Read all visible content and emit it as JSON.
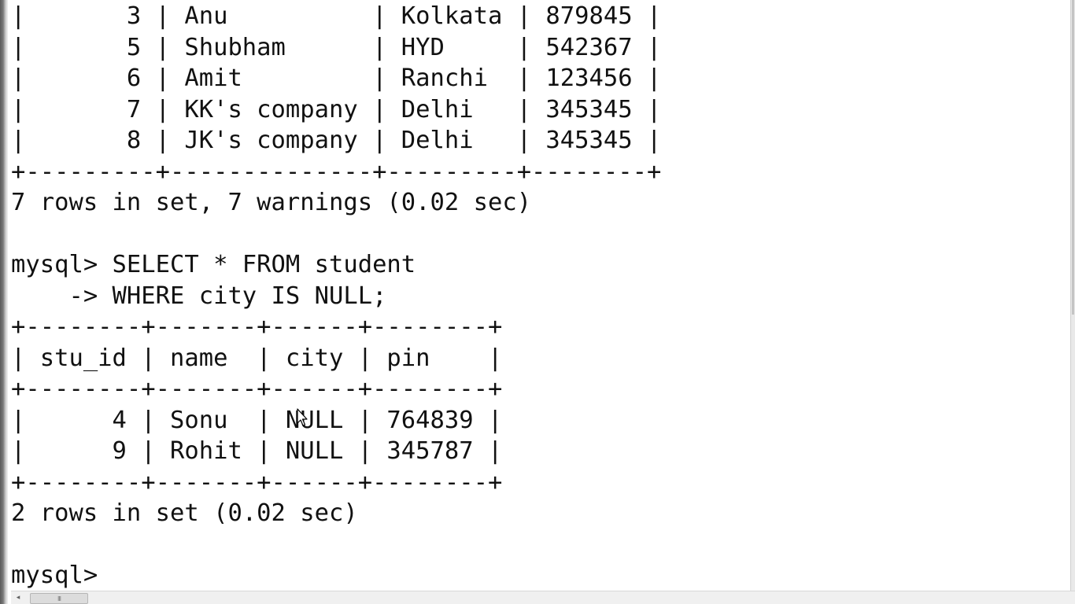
{
  "terminal": {
    "lines": [
      "|       3 | Anu          | Kolkata | 879845 |",
      "|       5 | Shubham      | HYD     | 542367 |",
      "|       6 | Amit         | Ranchi  | 123456 |",
      "|       7 | KK's company | Delhi   | 345345 |",
      "|       8 | JK's company | Delhi   | 345345 |",
      "+---------+--------------+---------+--------+",
      "7 rows in set, 7 warnings (0.02 sec)",
      "",
      "mysql> SELECT * FROM student",
      "    -> WHERE city IS NULL;",
      "+--------+-------+------+--------+",
      "| stu_id | name  | city | pin    |",
      "+--------+-------+------+--------+",
      "|      4 | Sonu  | NULL | 764839 |",
      "|      9 | Rohit | NULL | 345787 |",
      "+--------+-------+------+--------+",
      "2 rows in set (0.02 sec)",
      "",
      "mysql> "
    ]
  },
  "scrollbar": {
    "left_arrow": "◂",
    "grip": "III"
  },
  "icons": {
    "mouse": "arrow-pointer-icon"
  }
}
